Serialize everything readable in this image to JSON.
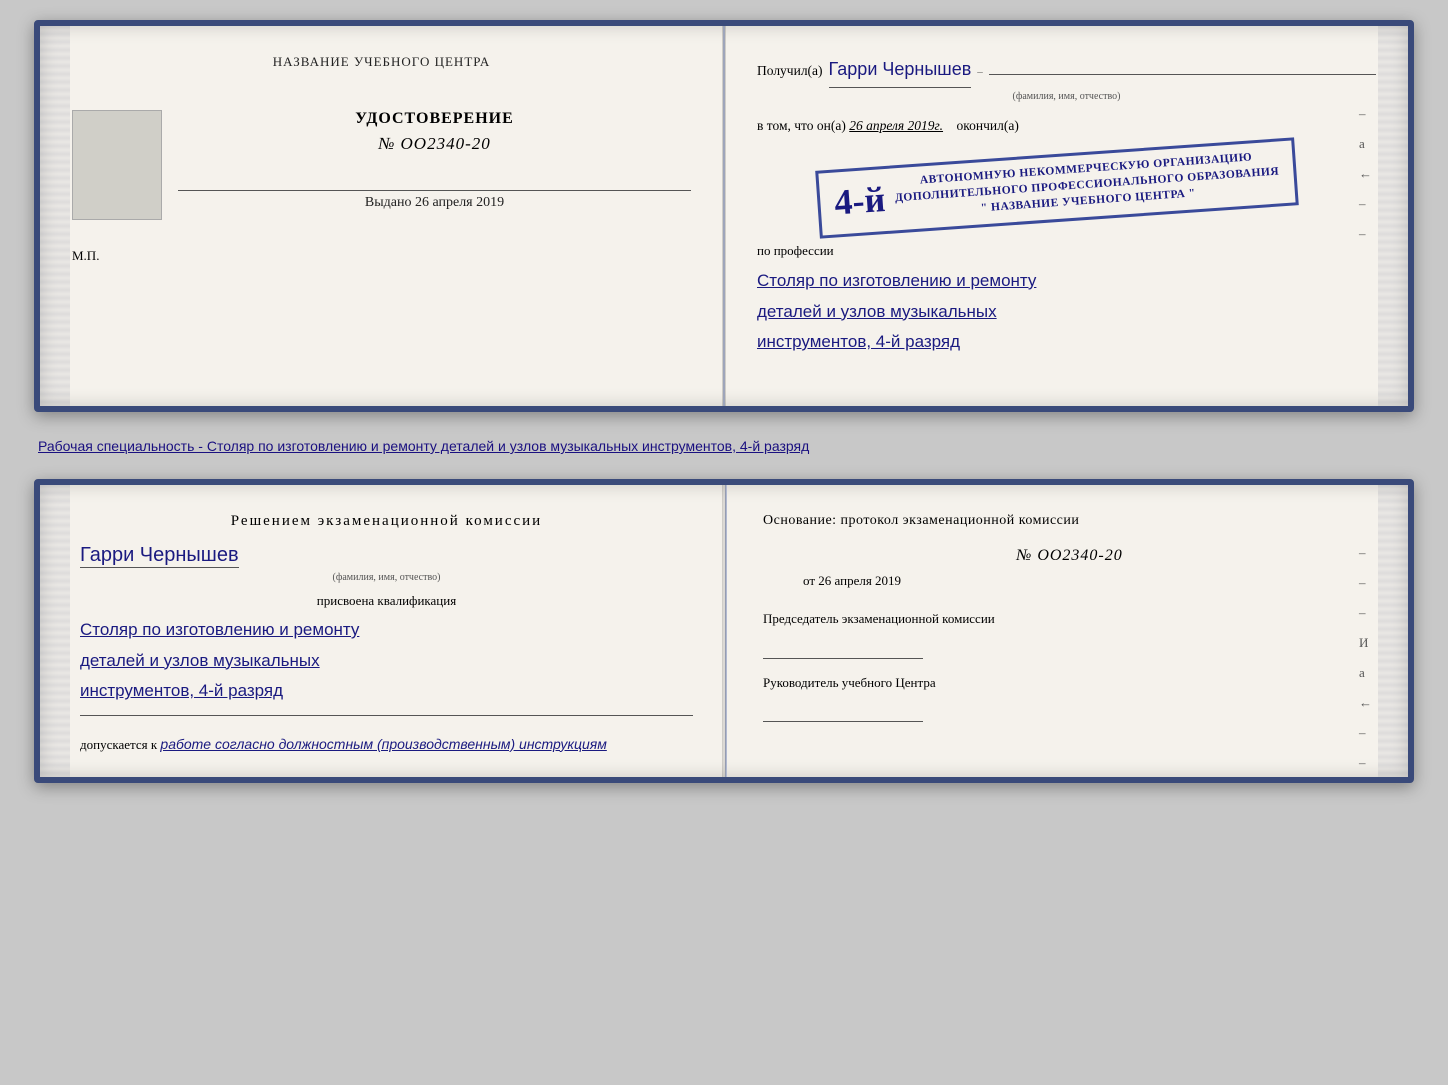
{
  "page": {
    "background": "#c8c8c8"
  },
  "top_left": {
    "title": "НАЗВАНИЕ УЧЕБНОГО ЦЕНТРА",
    "udostoverenie_label": "УДОСТОВЕРЕНИЕ",
    "number": "№ OO2340-20",
    "vydano_label": "Выдано",
    "vydano_date": "26 апреля 2019",
    "mp": "М.П."
  },
  "top_right": {
    "poluchil_label": "Получил(а)",
    "recipient_name": "Гарри Чернышев",
    "fio_label": "(фамилия, имя, отчество)",
    "vtom_label": "в том, что он(а)",
    "vtom_date": "26 апреля 2019г.",
    "okonchil_label": "окончил(а)",
    "stamp_rank": "4-й",
    "stamp_line1": "АВТОНОМНУЮ НЕКОММЕРЧЕСКУЮ ОРГАНИЗАЦИЮ",
    "stamp_line2": "ДОПОЛНИТЕЛЬНОГО ПРОФЕССИОНАЛЬНОГО ОБРАЗОВАНИЯ",
    "stamp_line3": "\" НАЗВАНИЕ УЧЕБНОГО ЦЕНТРА \"",
    "po_professii_label": "по профессии",
    "profession_line1": "Столяр по изготовлению и ремонту",
    "profession_line2": "деталей и узлов музыкальных",
    "profession_line3": "инструментов, 4-й разряд",
    "dash1": "–",
    "dash2": "а",
    "dash3": "←",
    "dash4": "–",
    "dash5": "–"
  },
  "caption": {
    "text": "Рабочая специальность - Столяр по изготовлению и ремонту деталей и узлов музыкальных инструментов, 4-й разряд"
  },
  "bottom_left": {
    "resheniem_label": "Решением экзаменационной комиссии",
    "name": "Гарри Чернышев",
    "fio_label": "(фамилия, имя, отчество)",
    "prisvoena_label": "присвоена квалификация",
    "qualification_line1": "Столяр по изготовлению и ремонту",
    "qualification_line2": "деталей и узлов музыкальных",
    "qualification_line3": "инструментов, 4-й разряд",
    "dopuskaetsya_label": "допускается к",
    "dopusk_text": "работе согласно должностным (производственным) инструкциям"
  },
  "bottom_right": {
    "osnovanie_label": "Основание: протокол экзаменационной комиссии",
    "number": "№ OO2340-20",
    "ot_label": "от",
    "ot_date": "26 апреля 2019",
    "predsedatel_label": "Председатель экзаменационной комиссии",
    "rukovoditel_label": "Руководитель учебного Центра",
    "dash1": "–",
    "dash2": "–",
    "dash3": "–",
    "dash4": "И",
    "dash5": "а",
    "dash6": "←",
    "dash7": "–",
    "dash8": "–",
    "dash9": "–"
  }
}
